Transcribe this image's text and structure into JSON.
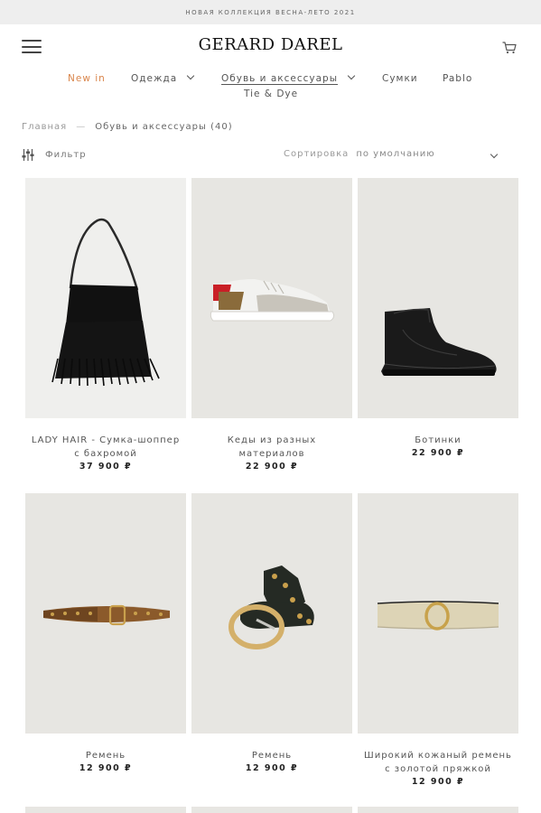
{
  "promo": {
    "text": "НОВАЯ КОЛЛЕКЦИЯ ВЕСНА-ЛЕТО 2021"
  },
  "header": {
    "logo": "GERARD DAREL",
    "menu_icon": "hamburger-icon",
    "cart_icon": "cart-icon"
  },
  "nav": {
    "items": [
      {
        "label": "New in",
        "active": true
      },
      {
        "label": "Одежда",
        "has_dropdown": true
      },
      {
        "label": "Обувь и аксессуары",
        "has_dropdown": true,
        "current": true
      },
      {
        "label": "Сумки"
      },
      {
        "label": "Pablo"
      },
      {
        "label": "Tie & Dye"
      }
    ],
    "active_color": "#d9844a"
  },
  "breadcrumb": {
    "home": "Главная",
    "separator": "—",
    "current": "Обувь и аксессуары (40)"
  },
  "toolbar": {
    "filter_label": "Фильтр",
    "sort_label": "Сортировка",
    "sort_value": "по умолчанию"
  },
  "products": [
    {
      "name": "LADY HAIR - Сумка-шоппер с бахромой",
      "price": "37 900 ₽",
      "image": "fringe-bag"
    },
    {
      "name": "Кеды из разных материалов",
      "price": "22 900 ₽",
      "image": "sneaker"
    },
    {
      "name": "Ботинки",
      "price": "22 900 ₽",
      "image": "ankle-boot"
    },
    {
      "name": "Ремень",
      "price": "12 900 ₽",
      "image": "brown-studded-belt"
    },
    {
      "name": "Ремень",
      "price": "12 900 ₽",
      "image": "black-studded-belt"
    },
    {
      "name": "Широкий кожаный ремень с золотой пряжкой",
      "price": "12 900 ₽",
      "image": "gold-belt"
    }
  ]
}
